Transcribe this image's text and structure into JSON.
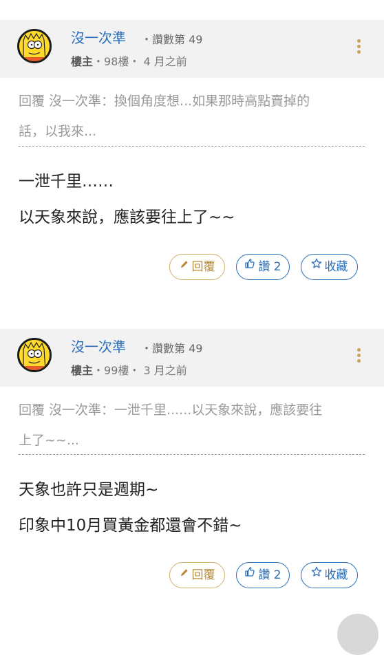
{
  "posts": [
    {
      "author": "沒一次準",
      "likes_meta": "・讚數第 49",
      "role": "樓主",
      "floor": "・98樓・",
      "time": "4 月之前",
      "quote_line1": "回覆 沒一次準：換個角度想...如果那時高點賣掉的",
      "quote_line2": "話，以我來...",
      "content": [
        "一泄千里……",
        "以天象來說，應該要往上了~~"
      ],
      "reply_label": "回覆",
      "like_label": "讚 2",
      "fav_label": "收藏"
    },
    {
      "author": "沒一次準",
      "likes_meta": "・讚數第 49",
      "role": "樓主",
      "floor": "・99樓・",
      "time": "3 月之前",
      "quote_line1": "回覆 沒一次準：一泄千里......以天象來說，應該要往",
      "quote_line2": "上了~~...",
      "content": [
        "天象也許只是週期~",
        "印象中10月買黃金都還會不錯~"
      ],
      "reply_label": "回覆",
      "like_label": "讚 2",
      "fav_label": "收藏"
    }
  ],
  "icons": {
    "avatar": "cartoon-avatar",
    "more": "vertical-ellipsis-icon",
    "reply": "pencil-icon",
    "like": "thumbs-up-icon",
    "fav": "star-icon"
  },
  "colors": {
    "author": "#2a6eb8",
    "reply_button": "#b68a3a",
    "like_button": "#2a6eb8",
    "header_bg": "#f2f2f2"
  }
}
